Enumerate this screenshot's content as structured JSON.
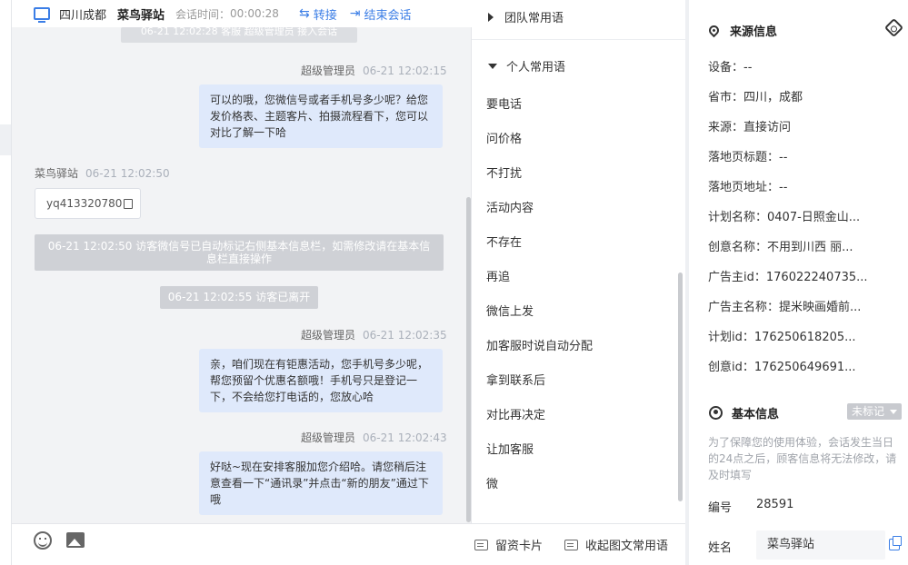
{
  "header": {
    "location": "四川成都",
    "visitor_name": "菜鸟驿站",
    "session_time_label": "会话时间：",
    "session_time": "00:00:28",
    "transfer_label": "转接",
    "end_session_label": "结束会话"
  },
  "messages": {
    "top_system_partial": "06-21 12:02:28 客服 超级管理员 接入会话",
    "m1": {
      "sender": "超级管理员",
      "time": "06-21 12:02:15",
      "text": "可以的哦，您微信号或者手机号多少呢？给您发价格表、主题客片、拍摄流程看下，您可以对比了解一下哈"
    },
    "m2": {
      "sender": "菜鸟驿站",
      "time": "06-21 12:02:50",
      "card_text": "yq413320780"
    },
    "sys1": "06-21 12:02:50 访客微信号已自动标记右侧基本信息栏，如需修改请在基本信息栏直接操作",
    "sys2": "06-21 12:02:55 访客已离开",
    "m3": {
      "sender": "超级管理员",
      "time": "06-21 12:02:35",
      "text": "亲，咱们现在有钜惠活动，您手机号多少呢，帮您预留个优惠名额哦！手机号只是登记一下，不会给您打电话的，您放心哈"
    },
    "m4": {
      "sender": "超级管理员",
      "time": "06-21 12:02:43",
      "text": "好哒~现在安排客服加您介绍哈。请您稍后注意查看一下“通讯录”并点击“新的朋友”通过下哦"
    }
  },
  "phrases": {
    "team_group": "团队常用语",
    "personal_group": "个人常用语",
    "items": [
      "要电话",
      "问价格",
      "不打扰",
      "活动内容",
      "不存在",
      "再追",
      "微信上发",
      "加客服时说自动分配",
      "拿到联系后",
      "对比再决定",
      "让加客服",
      "微"
    ],
    "footer_card": "留资卡片",
    "footer_collapse": "收起图文常用语"
  },
  "info": {
    "source_title": "来源信息",
    "rows": [
      {
        "label": "设备：",
        "value": "--"
      },
      {
        "label": "省市：",
        "value": "四川，成都"
      },
      {
        "label": "来源：",
        "value": "直接访问"
      },
      {
        "label": "落地页标题：",
        "value": "--"
      },
      {
        "label": "落地页地址：",
        "value": "--"
      },
      {
        "label": "计划名称：",
        "value": "0407-日照金山..."
      },
      {
        "label": "创意名称：",
        "value": "不用到川西 丽..."
      },
      {
        "label": "广告主id：",
        "value": "176022240735..."
      },
      {
        "label": "广告主名称：",
        "value": "提米映画婚前..."
      },
      {
        "label": "计划id：",
        "value": "176250618205..."
      },
      {
        "label": "创意id：",
        "value": "176250649691..."
      }
    ],
    "basic_title": "基本信息",
    "tag_label": "未标记",
    "note": "为了保障您的使用体验，会话发生当日的24点之后，顾客信息将无法修改，请及时填写",
    "id_label": "编号",
    "id_value": "28591",
    "name_label": "姓名",
    "name_value": "菜鸟驿站"
  },
  "colors": {
    "accent": "#3b7ee6",
    "bubble": "#dfe9fb",
    "system": "#cfd1d6"
  }
}
